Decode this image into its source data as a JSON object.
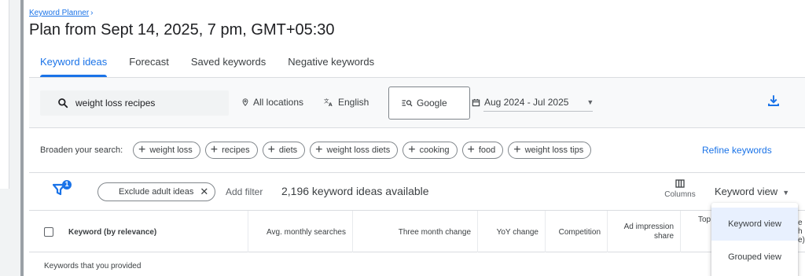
{
  "breadcrumb": {
    "label": "Keyword Planner",
    "chevron": "›"
  },
  "page": {
    "title": "Plan from Sept 14, 2025, 7 pm, GMT+05:30"
  },
  "tabs": [
    {
      "label": "Keyword ideas",
      "active": true
    },
    {
      "label": "Forecast",
      "active": false
    },
    {
      "label": "Saved keywords",
      "active": false
    },
    {
      "label": "Negative keywords",
      "active": false
    }
  ],
  "toolbar": {
    "search_value": "weight loss recipes",
    "search_icon": "search-icon",
    "locations_label": "All locations",
    "language_label": "English",
    "network_label": "Google",
    "date_range": "Aug 2024 - Jul 2025",
    "download_icon": "download-icon"
  },
  "broaden": {
    "label": "Broaden your search:",
    "chips": [
      "weight loss",
      "recipes",
      "diets",
      "weight loss diets",
      "cooking",
      "food",
      "weight loss tips"
    ],
    "refine_label": "Refine keywords"
  },
  "filterbar": {
    "filter_badge": "1",
    "exclude_pill": "Exclude adult ideas",
    "add_filter": "Add filter",
    "ideas_count": "2,196 keyword ideas available",
    "columns_label": "Columns",
    "view_label": "Keyword view"
  },
  "table": {
    "columns": [
      "Keyword (by relevance)",
      "Avg. monthly searches",
      "Three month change",
      "YoY change",
      "Competition",
      "Ad impression share",
      "Top of page bid"
    ],
    "top_bid_partial_1": "Top c",
    "top_bid_partial_2": "b",
    "right_partial": [
      "e",
      "h",
      "e)"
    ],
    "section_label": "Keywords that you provided"
  },
  "dropdown": {
    "items": [
      {
        "label": "Keyword view",
        "selected": true
      },
      {
        "label": "Grouped view",
        "selected": false
      }
    ]
  },
  "colors": {
    "accent": "#1a73e8",
    "border": "#dadce0",
    "text": "#3c4043"
  }
}
